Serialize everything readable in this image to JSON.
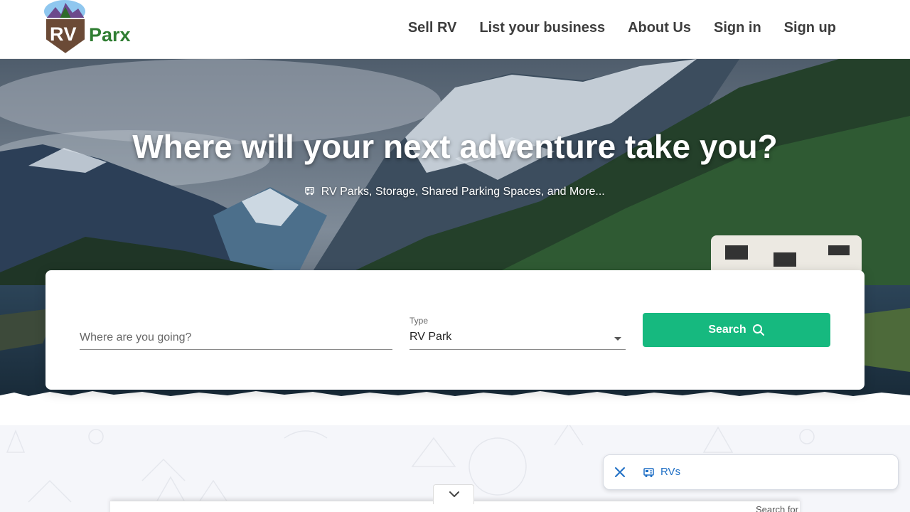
{
  "brand": {
    "rv": "RV",
    "parx": "Parx"
  },
  "nav": {
    "sell_rv": "Sell RV",
    "list_business": "List your business",
    "about_us": "About Us",
    "sign_in": "Sign in",
    "sign_up": "Sign up"
  },
  "hero": {
    "title": "Where will your next adventure take you?",
    "subtitle": "RV Parks, Storage, Shared Parking Spaces, and More..."
  },
  "search": {
    "where_placeholder": "Where are you going?",
    "type_label": "Type",
    "type_value": "RV Park",
    "button_label": "Search"
  },
  "chip": {
    "label": "RVs"
  },
  "bottom_sheet": {
    "text": "Search for"
  },
  "colors": {
    "accent": "#16b97f",
    "brand_green": "#2f7d32",
    "brand_brown": "#6b4a36",
    "link_blue": "#1f6fc5"
  },
  "icons": [
    "search-icon",
    "close-icon",
    "rv-icon",
    "chevron-down-icon",
    "caret-down-icon"
  ]
}
